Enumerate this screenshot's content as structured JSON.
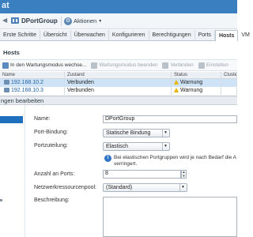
{
  "app": {
    "brand": "at"
  },
  "object": {
    "title": "DPortGroup",
    "actions_label": "Aktionen"
  },
  "tabs": [
    {
      "label": "Erste Schritte",
      "active": false
    },
    {
      "label": "Übersicht",
      "active": false
    },
    {
      "label": "Überwachen",
      "active": false
    },
    {
      "label": "Konfigurieren",
      "active": false
    },
    {
      "label": "Berechtigungen",
      "active": false
    },
    {
      "label": "Ports",
      "active": false
    },
    {
      "label": "Hosts",
      "active": true
    },
    {
      "label": "VM",
      "active": false
    }
  ],
  "section_label": "Hosts",
  "toolbar": {
    "maintenance_enter": "In den Wartungsmodus wechse...",
    "maintenance_exit": "Wartungsmodus beenden",
    "connect": "Verbinden",
    "add_host": "Einstellun"
  },
  "grid": {
    "columns": [
      "Name",
      "Zustand",
      "Status",
      "Cluster"
    ],
    "rows": [
      {
        "name": "192.168.10.2",
        "zustand": "Verbunden",
        "status": "Warnung",
        "cluster": ""
      },
      {
        "name": "192.168.10.3",
        "zustand": "Verbunden",
        "status": "Warnung",
        "cluster": ""
      }
    ]
  },
  "dialog": {
    "title": "ngen bearbeiten",
    "fields": {
      "name_label": "Name:",
      "name_value": "DPortGroup",
      "binding_label": "Port-Bindung:",
      "binding_value": "Statische Bindung",
      "allocation_label": "Portzuteilung:",
      "allocation_value": "Elastisch",
      "allocation_info_line1": "Bei elastischen Portgruppen wird je nach Bedarf die A",
      "allocation_info_line2": "verringert.",
      "ports_label": "Anzahl an Ports:",
      "ports_value": "8",
      "pool_label": "Netzwerkressourcenpool:",
      "pool_value": "(Standard)",
      "description_label": "Beschreibung:"
    }
  },
  "colors": {
    "topbar": "#3a7fc0",
    "selection": "#cfe3f6",
    "sidebar_selected": "#1f6fbf",
    "warning": "#e8b400"
  },
  "icons": [
    "back-arrow-icon",
    "portgroup-icon",
    "gear-icon",
    "host-icon",
    "warning-icon",
    "info-icon"
  ]
}
